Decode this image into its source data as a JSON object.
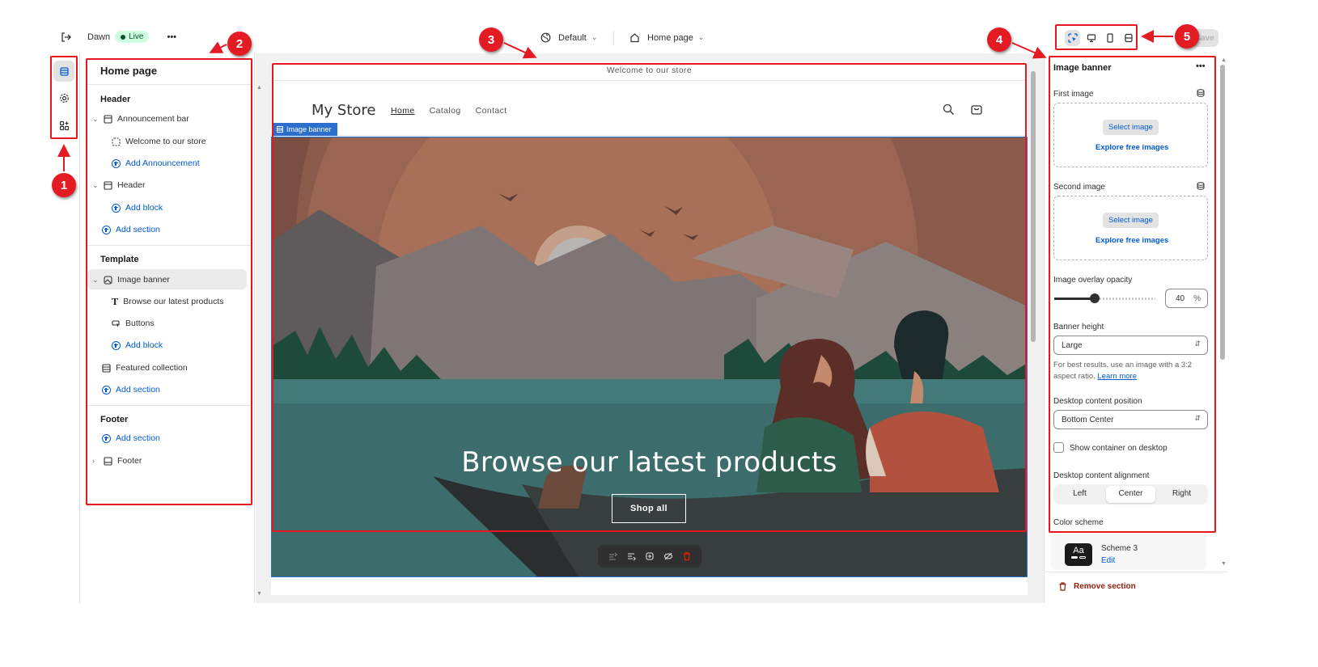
{
  "topbar": {
    "theme_name": "Dawn",
    "status": "Live",
    "more": "•••",
    "template_selector": "Default",
    "page_selector": "Home page",
    "save_label": "Save"
  },
  "sections_panel": {
    "title": "Home page",
    "header_group": "Header",
    "announcement_bar": "Announcement bar",
    "welcome_item": "Welcome to our store",
    "add_announcement": "Add Announcement",
    "header_item": "Header",
    "add_block_1": "Add block",
    "add_section_1": "Add section",
    "template_group": "Template",
    "image_banner": "Image banner",
    "browse_item": "Browse our latest products",
    "buttons_item": "Buttons",
    "add_block_2": "Add block",
    "featured_collection": "Featured collection",
    "add_section_2": "Add section",
    "footer_group": "Footer",
    "add_section_3": "Add section",
    "footer_item": "Footer"
  },
  "preview": {
    "announcement": "Welcome to our store",
    "store_name": "My Store",
    "nav": [
      "Home",
      "Catalog",
      "Contact"
    ],
    "section_tag": "Image banner",
    "banner_heading": "Browse our latest products",
    "banner_button": "Shop all"
  },
  "settings_panel": {
    "title": "Image banner",
    "more": "•••",
    "first_image_label": "First image",
    "second_image_label": "Second image",
    "select_image": "Select image",
    "explore_free_images": "Explore free images",
    "overlay_label": "Image overlay opacity",
    "overlay_value": "40",
    "overlay_unit": "%",
    "overlay_fraction": 0.4,
    "banner_height_label": "Banner height",
    "banner_height_value": "Large",
    "help_text": "For best results, use an image with a 3:2 aspect ratio.",
    "learn_more": "Learn more",
    "desktop_position_label": "Desktop content position",
    "desktop_position_value": "Bottom Center",
    "show_container_label": "Show container on desktop",
    "alignment_label": "Desktop content alignment",
    "alignment_options": [
      "Left",
      "Center",
      "Right"
    ],
    "alignment_selected": "Center",
    "color_scheme_label": "Color scheme",
    "scheme_swatch_text": "Aa",
    "scheme_name": "Scheme 3",
    "scheme_edit": "Edit",
    "remove_section": "Remove section"
  },
  "callouts": [
    "1",
    "2",
    "3",
    "4",
    "5"
  ],
  "colors": {
    "accent_blue": "#005bd3",
    "annotation_red": "#e8161d",
    "live_green": "#cdfee1",
    "remove_red": "#8e1f0b"
  }
}
